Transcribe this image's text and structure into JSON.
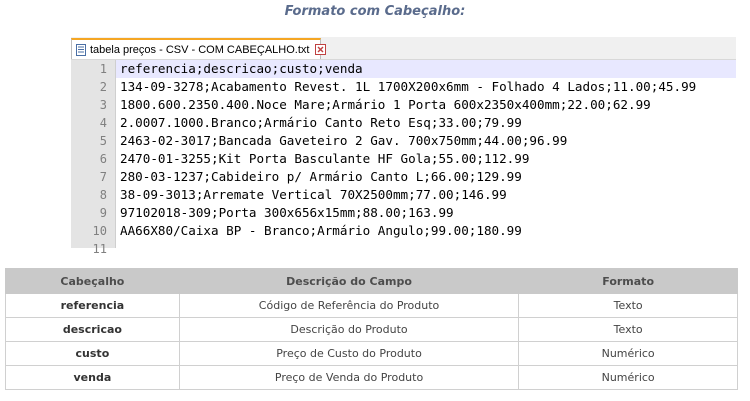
{
  "heading": "Formato com Cabeçalho:",
  "editor": {
    "tab": {
      "title": "tabela preços - CSV - COM CABEÇALHO.txt",
      "icon": "text-file-icon",
      "close_icon": "close-icon",
      "accent_color": "#f5a623"
    },
    "lines": [
      {
        "number": "1",
        "text": "referencia;descricao;custo;venda"
      },
      {
        "number": "2",
        "text": "134-09-3278;Acabamento Revest. 1L 1700X200x6mm - Folhado 4 Lados;11.00;45.99"
      },
      {
        "number": "3",
        "text": "1800.600.2350.400.Noce Mare;Armário 1 Porta 600x2350x400mm;22.00;62.99"
      },
      {
        "number": "4",
        "text": "2.0007.1000.Branco;Armário Canto Reto Esq;33.00;79.99"
      },
      {
        "number": "5",
        "text": "2463-02-3017;Bancada Gaveteiro 2 Gav. 700x750mm;44.00;96.99"
      },
      {
        "number": "6",
        "text": "2470-01-3255;Kit Porta Basculante HF Gola;55.00;112.99"
      },
      {
        "number": "7",
        "text": "280-03-1237;Cabideiro p/ Armário Canto L;66.00;129.99"
      },
      {
        "number": "8",
        "text": "38-09-3013;Arremate Vertical 70X2500mm;77.00;146.99"
      },
      {
        "number": "9",
        "text": "97102018-309;Porta 300x656x15mm;88.00;163.99"
      },
      {
        "number": "10",
        "text": "AA66X80/Caixa BP - Branco;Armário Angulo;99.00;180.99"
      },
      {
        "number": "11",
        "text": ""
      }
    ]
  },
  "fields_table": {
    "headers": [
      "Cabeçalho",
      "Descrição do Campo",
      "Formato"
    ],
    "rows": [
      [
        "referencia",
        "Código de Referência do Produto",
        "Texto"
      ],
      [
        "descricao",
        "Descrição do Produto",
        "Texto"
      ],
      [
        "custo",
        "Preço de Custo do Produto",
        "Numérico"
      ],
      [
        "venda",
        "Preço de Venda do Produto",
        "Numérico"
      ]
    ]
  }
}
